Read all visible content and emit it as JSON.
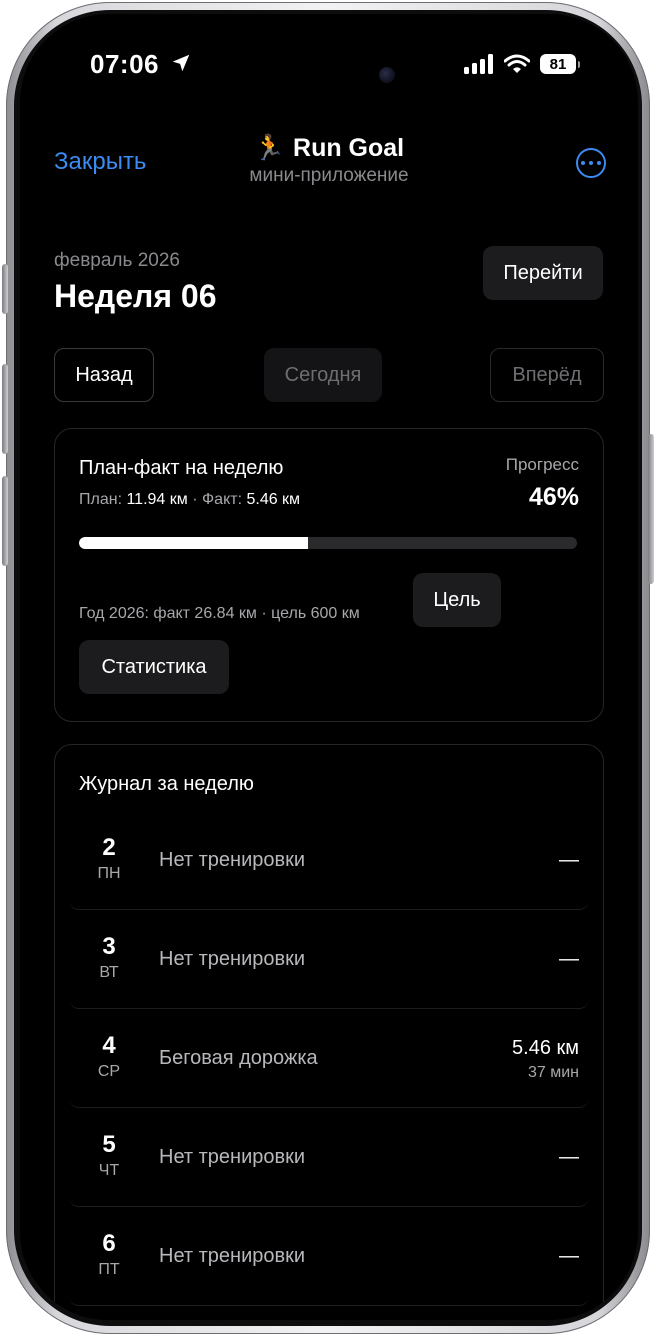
{
  "status_bar": {
    "time": "07:06",
    "battery": "81"
  },
  "nav": {
    "close_label": "Закрыть",
    "title": "Run Goal",
    "title_emoji": "🏃",
    "subtitle": "мини-приложение"
  },
  "header": {
    "month": "февраль 2026",
    "week": "Неделя 06",
    "go_label": "Перейти"
  },
  "week_nav": {
    "back_label": "Назад",
    "today_label": "Сегодня",
    "forward_label": "Вперёд"
  },
  "plan_card": {
    "title": "План-факт на неделю",
    "plan_label": "План:",
    "plan_value": "11.94 км",
    "sep": "·",
    "fact_label": "Факт:",
    "fact_value": "5.46 км",
    "progress_label": "Прогресс",
    "progress_value": "46%",
    "progress_fraction": 0.46,
    "year_line": "Год 2026: факт 26.84 км · цель 600 км",
    "goal_label": "Цель",
    "stats_label": "Статистика"
  },
  "log": {
    "title": "Журнал за неделю",
    "rows": [
      {
        "day": "2",
        "weekday": "ПН",
        "label": "Нет тренировки",
        "value": "—",
        "sub": ""
      },
      {
        "day": "3",
        "weekday": "ВТ",
        "label": "Нет тренировки",
        "value": "—",
        "sub": ""
      },
      {
        "day": "4",
        "weekday": "СР",
        "label": "Беговая дорожка",
        "value": "5.46 км",
        "sub": "37 мин"
      },
      {
        "day": "5",
        "weekday": "ЧТ",
        "label": "Нет тренировки",
        "value": "—",
        "sub": ""
      },
      {
        "day": "6",
        "weekday": "ПТ",
        "label": "Нет тренировки",
        "value": "—",
        "sub": ""
      }
    ]
  },
  "colors": {
    "accent": "#3b8bf0",
    "background": "#000000",
    "card_border": "#262628",
    "button_bg": "#1c1c1e"
  }
}
